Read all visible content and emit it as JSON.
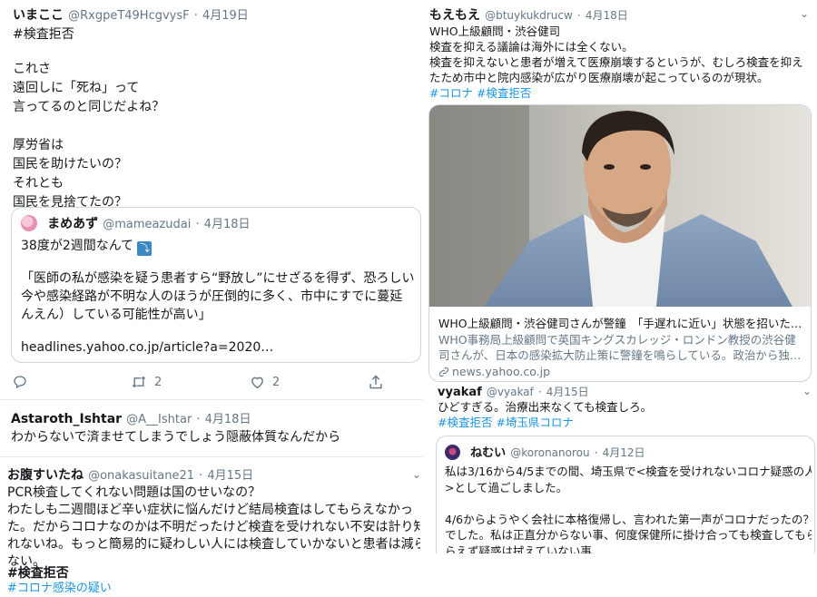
{
  "tweet1": {
    "name": "いまここ",
    "handle": "@RxgpeT49HcgvysF",
    "sep": "·",
    "date": "4月19日",
    "hashtag": "#検査拒否",
    "lines": [
      "これさ",
      "遠回しに「死ね」って",
      "言ってるのと同じだよね？",
      "",
      "厚労省は",
      "国民を助けたいの？",
      "それとも",
      "国民を見捨てたの？"
    ],
    "quote": {
      "name": "まめあず",
      "handle": "@mameazudai",
      "sep": "·",
      "date": "4月18日",
      "line1": "38度が2週間なんて",
      "line1_emoji": "⤵",
      "body": [
        "「医師の私が感染を疑う患者すら“野放し”にせざるを得ず、恐ろしい",
        "今や感染経路が不明な人のほうが圧倒的に多く、市中にすでに蔓延",
        "んえん）している可能性が高い」"
      ],
      "link": "headlines.yahoo.co.jp/article?a=2020…"
    },
    "actions": {
      "retweets": "2",
      "likes": "2"
    }
  },
  "tweet2": {
    "name": "Astaroth_Ishtar",
    "handle": "@A__Ishtar",
    "sep": "·",
    "date": "4月18日",
    "text": "わからないで済ませてしまうでしょう隠蔽体質なんだから"
  },
  "tweet3": {
    "name": "お腹すいたね",
    "handle": "@onakasuitane21",
    "sep": "·",
    "date": "4月15日",
    "lines": [
      "PCR検査してくれない問題は国のせいなの？",
      "わたしも二週間ほど辛い症状に悩んだけど結局検査はしてもらえなかっ",
      "た。だからコロナなのかは不明だったけど検査を受けれない不安は計り知",
      "れないね。もっと簡易的に疑わしい人には検査していかないと患者は減ら",
      "ない。"
    ],
    "hashtag1": "#検査拒否",
    "hashtag2": "#コロナ感染の疑い"
  },
  "tweet4": {
    "name": "もえもえ",
    "handle": "@btuykukdrucw",
    "sep": "·",
    "date": "4月18日",
    "lines": [
      "WHO上級顧問・渋谷健司",
      "検査を抑える議論は海外には全くない。",
      "検査を抑えないと患者が増えて医療崩壊するというが、むしろ検査を抑え",
      "たため市中と院内感染が広がり医療崩壊が起こっているのが現状。"
    ],
    "hashtags": "#コロナ #検査拒否",
    "card": {
      "title": "WHO上級顧問・渋谷健司さんが警鐘　「手遅れに近い」状態を招いた…",
      "desc": [
        "WHO事務局上級顧問で英国キングスカレッジ・ロンドン教授の渋谷健",
        "司さんが、日本の感染拡大防止策に警鐘を鳴らしている。政治から独…"
      ],
      "domain": "news.yahoo.co.jp"
    }
  },
  "tweet5": {
    "name": "vyakaf",
    "handle": "@vyakaf",
    "sep": "·",
    "date": "4月15日",
    "text": "ひどすぎる。治療出来なくても検査しろ。",
    "hashtags": "#検査拒否 #埼玉県コロナ",
    "quote": {
      "name": "ねむい",
      "handle": "@koronanorou",
      "sep": "·",
      "date": "4月12日",
      "lines": [
        "私は3/16から4/5までの間、埼玉県で<検査を受けれないコロナ疑惑の人",
        ">として過ごしました。",
        "",
        "4/6からようやく会社に本格復帰し、言われた第一声がコロナだったの？",
        "でした。私は正直分からない事、何度保健所に掛け合っても検査してもら",
        "らえず疑惑は拭えていない事、"
      ]
    }
  },
  "colors": {
    "link": "#1b95e0",
    "muted": "#657786",
    "border": "#ccd6dd"
  }
}
